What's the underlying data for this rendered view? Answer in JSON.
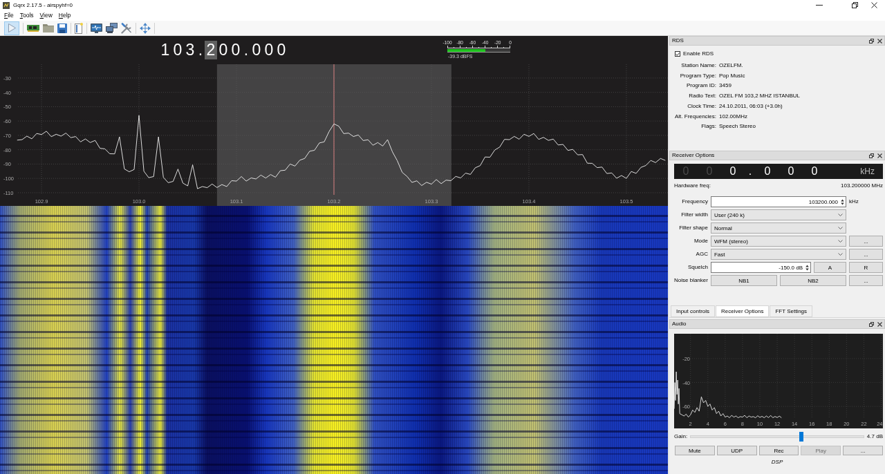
{
  "window": {
    "title": "Gqrx 2.17.5 - airspyhf=0"
  },
  "menu": [
    "File",
    "Tools",
    "View",
    "Help"
  ],
  "toolbar": {
    "start_toggle": {
      "checked": true
    }
  },
  "frequency_display": {
    "groups": [
      {
        "digits": [
          {
            "text": "1",
            "selected": false
          },
          {
            "text": "0",
            "selected": false
          },
          {
            "text": "3",
            "selected": false
          }
        ]
      },
      {
        "digits": [
          {
            "text": "2",
            "selected": true
          },
          {
            "text": "0",
            "selected": false
          },
          {
            "text": "0",
            "selected": false
          }
        ]
      },
      {
        "digits": [
          {
            "text": "0",
            "selected": false
          },
          {
            "text": "0",
            "selected": false
          },
          {
            "text": "0",
            "selected": false
          }
        ]
      }
    ],
    "separators": [
      ".",
      "."
    ]
  },
  "signal_meter": {
    "scale": [
      "-100",
      "-80",
      "-60",
      "-40",
      "-20",
      "0"
    ],
    "level": 0.607,
    "reading": "-39.3 dBFS"
  },
  "spectrum": {
    "chart_data": {
      "type": "line",
      "grid": true,
      "xlim": [
        102.8574,
        103.5426
      ],
      "ylim": [
        -119.2,
        -20.4
      ],
      "xticks": [
        {
          "value": 102.9,
          "label": "102.9"
        },
        {
          "value": 103.0,
          "label": "103.0"
        },
        {
          "value": 103.1,
          "label": "103.1"
        },
        {
          "value": 103.2,
          "label": "103.2"
        },
        {
          "value": 103.3,
          "label": "103.3"
        },
        {
          "value": 103.4,
          "label": "103.4"
        },
        {
          "value": 103.5,
          "label": "103.5"
        }
      ],
      "yticks": [
        -30,
        -40,
        -50,
        -60,
        -70,
        -80,
        -90,
        -100,
        -110
      ],
      "bands": [
        {
          "axis": "x",
          "from": 103.08,
          "to": 103.3205,
          "color": "#444344"
        }
      ],
      "ref_lines": [
        {
          "axis": "x",
          "value": 103.2,
          "color": "#d88080"
        }
      ],
      "x": [
        102.875,
        102.88,
        102.885,
        102.89,
        102.895,
        102.9,
        102.905,
        102.91,
        102.915,
        102.92,
        102.925,
        102.93,
        102.935,
        102.94,
        102.945,
        102.95,
        102.955,
        102.96,
        102.965,
        102.97,
        102.975,
        102.98,
        102.985,
        102.99,
        102.995,
        103.0,
        103.005,
        103.01,
        103.015,
        103.02,
        103.025,
        103.03,
        103.035,
        103.04,
        103.045,
        103.05,
        103.055,
        103.06,
        103.065,
        103.07,
        103.075,
        103.08,
        103.085,
        103.09,
        103.095,
        103.1,
        103.105,
        103.11,
        103.115,
        103.12,
        103.125,
        103.13,
        103.135,
        103.14,
        103.145,
        103.15,
        103.155,
        103.16,
        103.165,
        103.17,
        103.175,
        103.18,
        103.185,
        103.19,
        103.195,
        103.2,
        103.205,
        103.21,
        103.215,
        103.22,
        103.225,
        103.23,
        103.235,
        103.24,
        103.245,
        103.25,
        103.255,
        103.26,
        103.265,
        103.27,
        103.275,
        103.28,
        103.285,
        103.29,
        103.295,
        103.3,
        103.305,
        103.31,
        103.315,
        103.32,
        103.325,
        103.33,
        103.335,
        103.34,
        103.345,
        103.35,
        103.355,
        103.36,
        103.365,
        103.37,
        103.375,
        103.38,
        103.385,
        103.39,
        103.395,
        103.4,
        103.405,
        103.41,
        103.415,
        103.42,
        103.425,
        103.43,
        103.435,
        103.44,
        103.445,
        103.45,
        103.455,
        103.46,
        103.465,
        103.47,
        103.475,
        103.48,
        103.485,
        103.49,
        103.495,
        103.5,
        103.505,
        103.51,
        103.515,
        103.52,
        103.525,
        103.53,
        103.535,
        103.54
      ],
      "series": [
        {
          "color": "#f0f0f0",
          "values": [
            -73.3,
            -73.0,
            -70.5,
            -72.4,
            -68.7,
            -69.4,
            -67.1,
            -70.9,
            -69.2,
            -70.5,
            -68.4,
            -71.6,
            -70.8,
            -74.5,
            -72.5,
            -75.0,
            -73.5,
            -79.0,
            -79.4,
            -82.8,
            -82.9,
            -71.0,
            -93.4,
            -95.4,
            -93.8,
            -56.0,
            -95.0,
            -99.5,
            -98.7,
            -71.0,
            -99.3,
            -103.0,
            -102.1,
            -93.5,
            -103.3,
            -105.2,
            -90.5,
            -107.2,
            -105.7,
            -106.5,
            -103.9,
            -106.4,
            -104.3,
            -105.7,
            -101.6,
            -101.9,
            -98.7,
            -101.9,
            -99.7,
            -100.4,
            -97.7,
            -99.8,
            -97.3,
            -99.2,
            -94.6,
            -94.3,
            -90.0,
            -91.4,
            -87.3,
            -86.1,
            -81.1,
            -80.4,
            -75.3,
            -74.5,
            -67.3,
            -62.0,
            -63.6,
            -68.8,
            -68.4,
            -70.8,
            -69.7,
            -73.6,
            -73.1,
            -76.9,
            -75.0,
            -77.4,
            -73.0,
            -81.5,
            -87.7,
            -95.8,
            -98.6,
            -102.8,
            -101.7,
            -105.0,
            -102.7,
            -104.0,
            -100.8,
            -103.7,
            -101.2,
            -101.6,
            -98.6,
            -99.7,
            -96.3,
            -97.2,
            -92.6,
            -91.1,
            -85.1,
            -85.2,
            -80.2,
            -78.2,
            -72.8,
            -73.0,
            -70.7,
            -72.7,
            -69.2,
            -70.7,
            -68.7,
            -72.8,
            -71.4,
            -73.5,
            -72.6,
            -76.7,
            -76.3,
            -80.5,
            -79.8,
            -83.6,
            -83.4,
            -89.4,
            -89.5,
            -92.5,
            -92.1,
            -96.6,
            -96.2,
            -99.9,
            -98.0,
            -100.0,
            -95.2,
            -96.5,
            -92.3,
            -91.0,
            -87.5,
            -89.0,
            -86.1,
            -87.5
          ]
        }
      ]
    }
  },
  "rds_panel": {
    "title": "RDS",
    "enable": {
      "label": "Enable RDS",
      "checked": true
    },
    "fields": [
      {
        "label": "Station Name:",
        "value": "OZELFM."
      },
      {
        "label": "Program Type:",
        "value": "Pop Music"
      },
      {
        "label": "Program ID:",
        "value": "3459"
      },
      {
        "label": "Radio Text:",
        "value": "OZEL FM 103,2 MHZ ISTANBUL"
      },
      {
        "label": "Clock Time:",
        "value": "24.10.2011, 06:03 (+3.0h)"
      },
      {
        "label": "Alt. Frequencies:",
        "value": "102.00MHz"
      },
      {
        "label": "Flags:",
        "value": "Speech Stereo"
      }
    ]
  },
  "receiver_options": {
    "title": "Receiver Options",
    "lcd": {
      "groups": [
        {
          "digits": [
            {
              "text": "0",
              "dim": true
            },
            {
              "text": "0",
              "dim": true
            },
            {
              "text": "0",
              "dim": false
            }
          ]
        },
        {
          "digits": [
            {
              "text": "0",
              "dim": false
            },
            {
              "text": "0",
              "dim": false
            },
            {
              "text": "0",
              "dim": false
            }
          ]
        }
      ],
      "separators": [
        "."
      ],
      "unit": "kHz"
    },
    "hardware_freq": {
      "label": "Hardware freq:",
      "value": "103.200000 MHz"
    },
    "rows": [
      {
        "kind": "spin",
        "label": "Frequency",
        "value": "103200.000",
        "unit": "kHz"
      },
      {
        "kind": "combo",
        "label": "Filter width",
        "value": "User (240 k)"
      },
      {
        "kind": "combo",
        "label": "Filter shape",
        "value": "Normal"
      },
      {
        "kind": "combo",
        "label": "Mode",
        "value": "WFM (stereo)",
        "buttons": [
          "..."
        ]
      },
      {
        "kind": "combo",
        "label": "AGC",
        "value": "Fast",
        "buttons": [
          "..."
        ]
      },
      {
        "kind": "spin",
        "label": "Squelch",
        "value": "-150.0 dB",
        "buttons": [
          "A",
          "R"
        ]
      },
      {
        "kind": "buttons",
        "label": "Noise blanker",
        "buttons": [
          "NB1",
          "NB2",
          "..."
        ]
      }
    ]
  },
  "dock_tabs": [
    {
      "label": "Input controls",
      "selected": false
    },
    {
      "label": "Receiver Options",
      "selected": true
    },
    {
      "label": "FFT Settings",
      "selected": false
    }
  ],
  "audio_panel": {
    "title": "Audio",
    "chart_data": {
      "type": "line",
      "grid": true,
      "xlim": [
        0.11,
        24.2
      ],
      "ylim": [
        -78.4,
        0.8
      ],
      "xticks": [
        2,
        4,
        6,
        8,
        10,
        12,
        14,
        16,
        18,
        20,
        22,
        24
      ],
      "yticks": [
        -20,
        -40,
        -60
      ],
      "x": [
        0.12,
        0.2,
        0.28,
        0.36,
        0.44,
        0.52,
        0.6,
        0.68,
        0.76,
        1.0,
        1.25,
        1.5,
        1.75,
        2.0,
        2.25,
        2.5,
        2.75,
        3.0,
        3.25,
        3.5,
        3.75,
        4.0,
        4.25,
        4.5,
        4.75,
        5.0,
        5.25,
        5.5,
        5.75,
        6.0,
        6.25,
        6.5,
        6.75,
        7.0,
        7.25,
        7.5,
        7.75,
        8.0,
        8.25,
        8.5,
        8.75,
        9.0,
        9.25,
        9.5,
        9.75,
        10.0,
        10.25,
        10.5,
        10.75,
        11.0,
        11.25,
        11.5,
        11.75,
        12.0,
        12.25,
        12.5
      ],
      "series": [
        {
          "color": "#e8e8e8",
          "values": [
            -62,
            -40,
            -55,
            -31,
            -50,
            -38,
            -58,
            -45,
            -66,
            -67,
            -68,
            -66.5,
            -69,
            -67,
            -63,
            -65,
            -61,
            -64,
            -52,
            -57,
            -55,
            -60,
            -58,
            -63,
            -61,
            -66,
            -64,
            -68,
            -66,
            -69,
            -68,
            -69.5,
            -67.5,
            -69,
            -68,
            -69.5,
            -68.5,
            -69,
            -67.5,
            -69.5,
            -68,
            -69,
            -68.5,
            -69.5,
            -67.8,
            -69.2,
            -68.3,
            -69.5,
            -68,
            -69.4,
            -67.6,
            -69.5,
            -68.4,
            -69.3,
            -68.1,
            -69.5
          ]
        }
      ]
    },
    "gain": {
      "label": "Gain:",
      "level": 0.64,
      "reading": "4.7 dB"
    },
    "buttons": [
      {
        "label": "Mute",
        "disabled": false
      },
      {
        "label": "UDP",
        "disabled": false
      },
      {
        "label": "Rec",
        "disabled": false
      },
      {
        "label": "Play",
        "disabled": true
      },
      {
        "label": "...",
        "disabled": false
      }
    ],
    "footer": "DSP"
  }
}
